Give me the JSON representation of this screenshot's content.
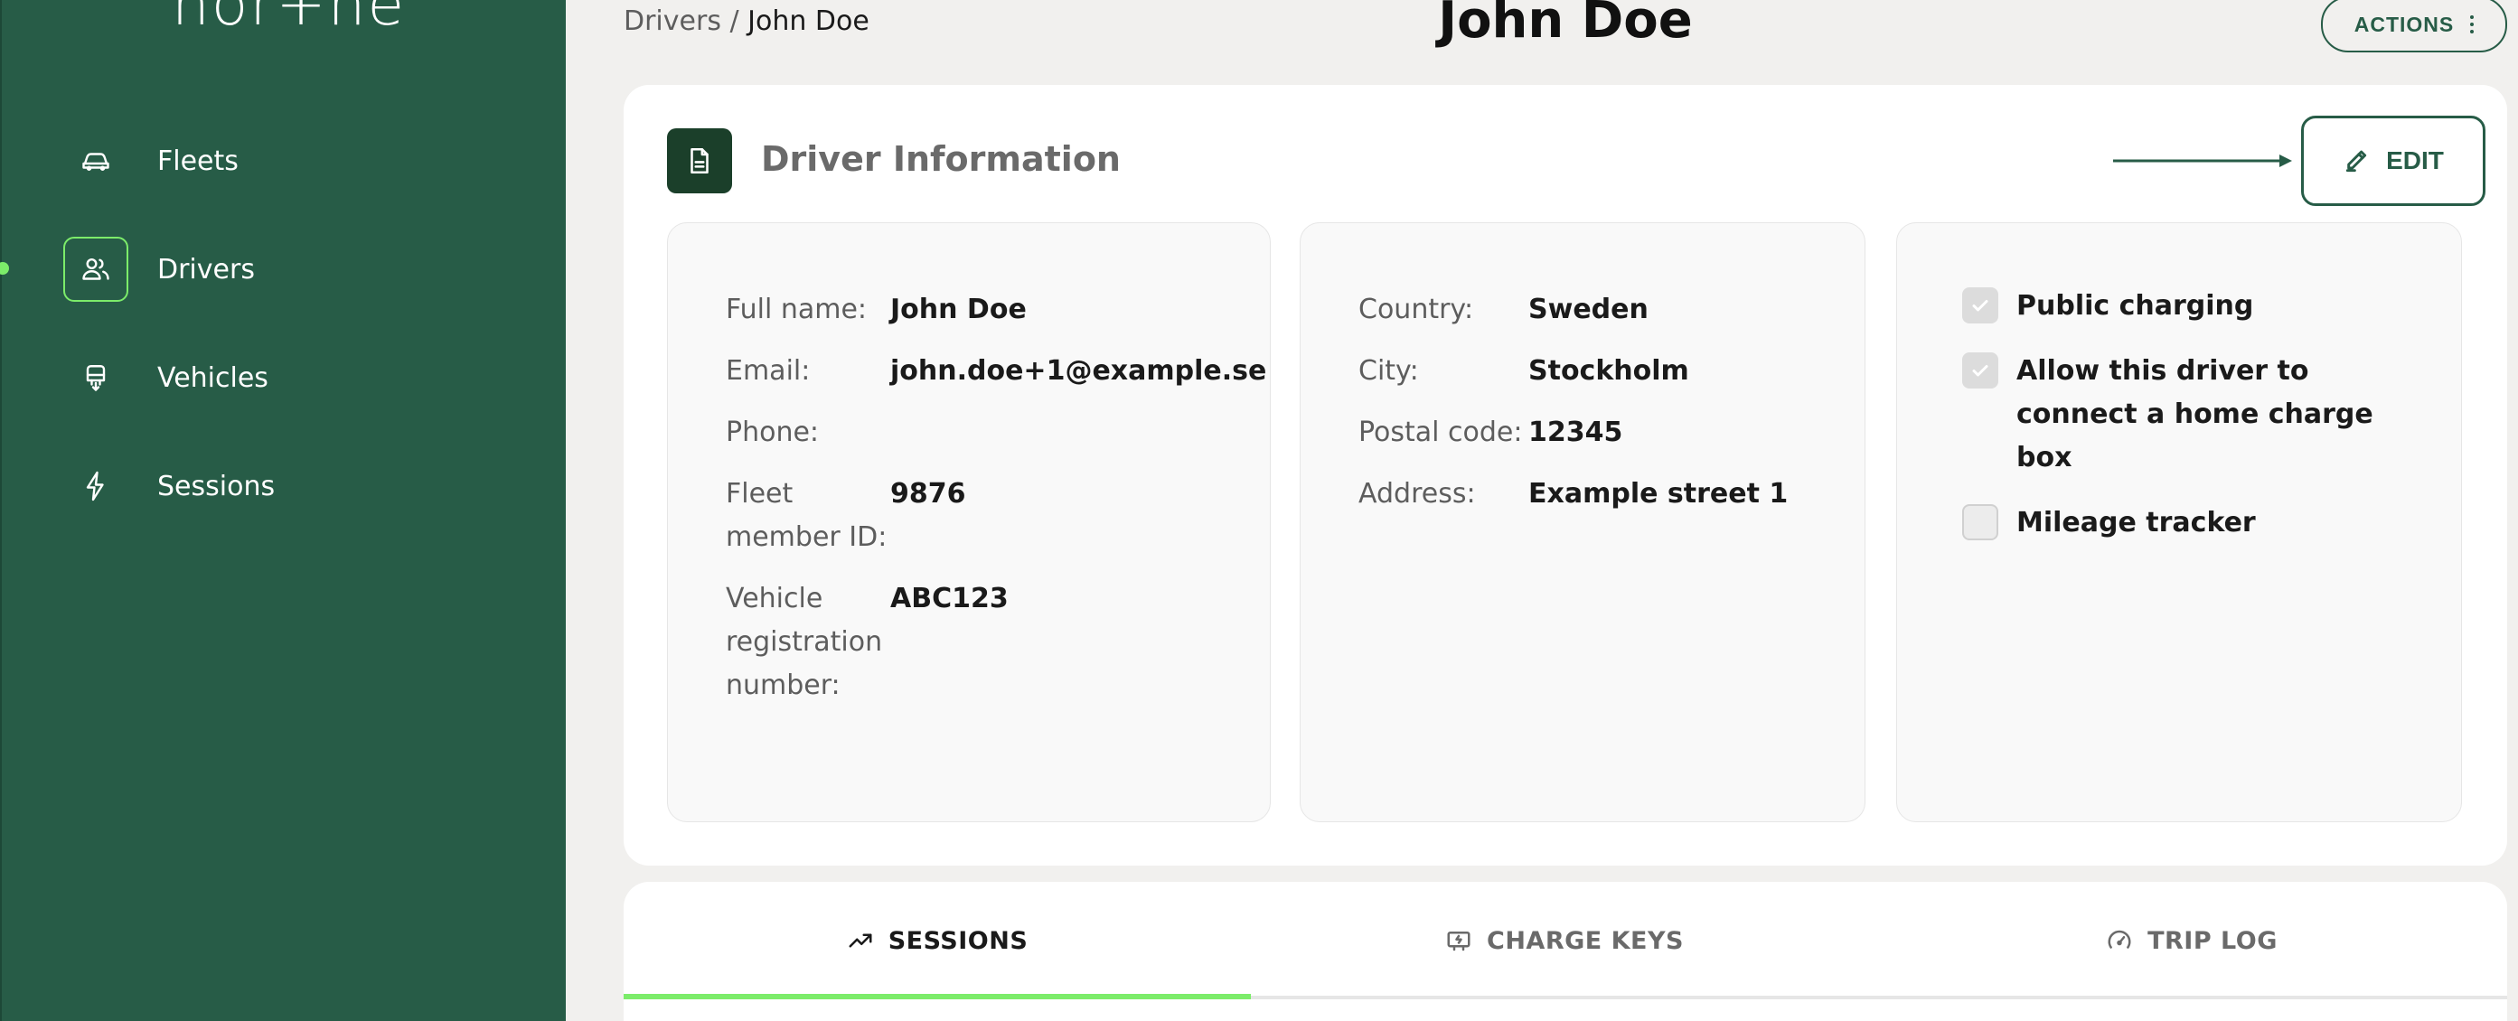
{
  "brand": {
    "logo_text": "nor+he"
  },
  "sidebar": {
    "items": [
      {
        "label": "Fleets",
        "icon": "car-icon",
        "active": false
      },
      {
        "label": "Drivers",
        "icon": "users-icon",
        "active": true
      },
      {
        "label": "Vehicles",
        "icon": "charger-icon",
        "active": false
      },
      {
        "label": "Sessions",
        "icon": "lightning-icon",
        "active": false
      }
    ]
  },
  "header": {
    "breadcrumb_parent": "Drivers",
    "breadcrumb_separator": " / ",
    "breadcrumb_current": "John Doe",
    "title": "John Doe",
    "actions_label": "ACTIONS"
  },
  "driver_info": {
    "title": "Driver Information",
    "edit_label": "EDIT",
    "personal": {
      "full_name_label": "Full name:",
      "full_name": "John Doe",
      "email_label": "Email:",
      "email": "john.doe+1@example.se",
      "phone_label": "Phone:",
      "phone": "",
      "fleet_member_id_label": "Fleet member ID:",
      "fleet_member_id": "9876",
      "vehicle_reg_label": "Vehicle registration number:",
      "vehicle_reg": "ABC123"
    },
    "address": {
      "country_label": "Country:",
      "country": "Sweden",
      "city_label": "City:",
      "city": "Stockholm",
      "postal_code_label": "Postal code:",
      "postal_code": "12345",
      "address_label": "Address:",
      "address": "Example street 1"
    },
    "options": [
      {
        "label": "Public charging",
        "checked": true
      },
      {
        "label": "Allow this driver to connect a home charge box",
        "checked": true
      },
      {
        "label": "Mileage tracker",
        "checked": false
      }
    ]
  },
  "tabs": [
    {
      "label": "SESSIONS",
      "icon": "trend-icon",
      "active": true
    },
    {
      "label": "CHARGE KEYS",
      "icon": "charge-key-icon",
      "active": false
    },
    {
      "label": "TRIP LOG",
      "icon": "speedometer-icon",
      "active": false
    }
  ],
  "colors": {
    "sidebar_bg": "#275c47",
    "accent": "#7cec6a",
    "primary": "#275c47",
    "page_bg": "#f1f0ee"
  }
}
